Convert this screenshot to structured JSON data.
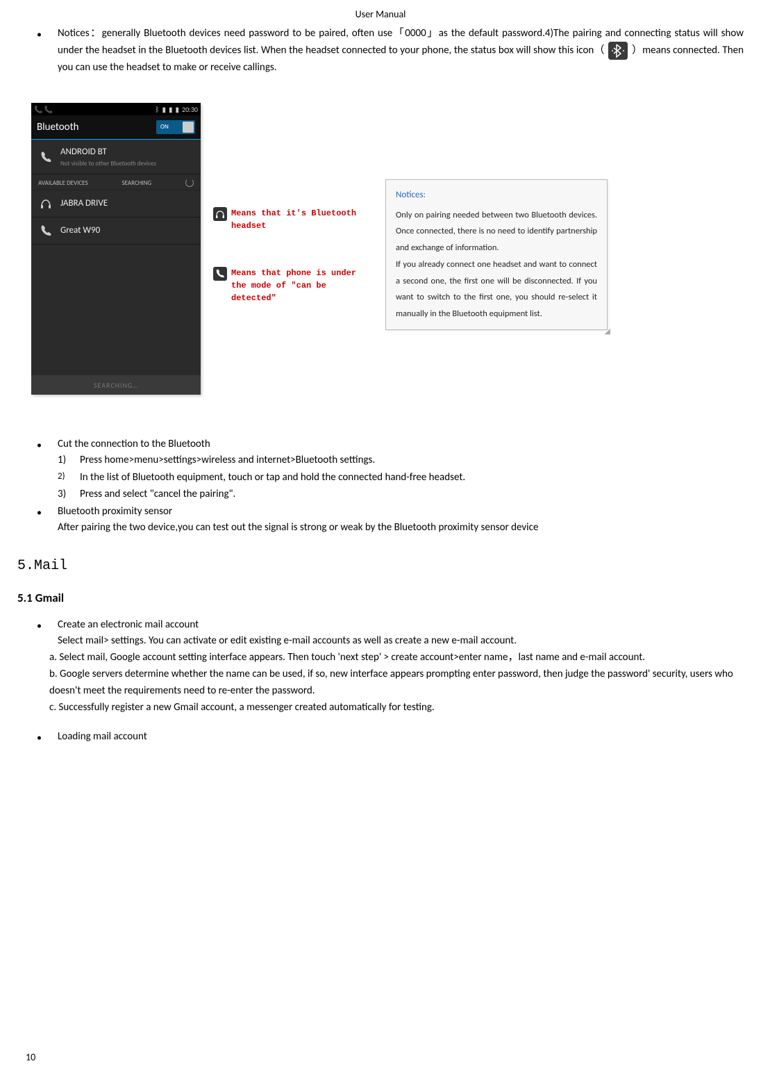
{
  "header": "User    Manual",
  "pageNumber": "10",
  "notices_bullet": {
    "lead": "Notices：generally Bluetooth devices need password to be paired, often use「0000」as the default password.4)The pairing and connecting status will show under the headset in the Bluetooth devices list. When the headset connected to your phone, the status box will show this icon（",
    "tail": "）means connected. Then you can use the headset to make or receive callings."
  },
  "phone": {
    "time": "20:30",
    "title": "Bluetooth",
    "toggle": "ON",
    "self": {
      "name": "ANDROID BT",
      "sub": "Not visible to other Bluetooth devices"
    },
    "labels": {
      "available": "AVAILABLE DEVICES",
      "searching": "SEARCHING"
    },
    "devices": [
      {
        "name": "JABRA DRIVE",
        "icon": "headphones"
      },
      {
        "name": "Great W90",
        "icon": "phone"
      }
    ],
    "footer": "SEARCHING…"
  },
  "callouts": {
    "c1": "Means that it's Bluetooth headset",
    "c2": "Means that phone is under the mode of \"can be detected\""
  },
  "noticeBox": {
    "title": "Notices:",
    "p1": "Only on pairing needed between two Bluetooth devices. Once connected, there is no need to identify partnership and exchange of information.",
    "p2": "If you already connect one headset and want to connect a second one, the first one will be disconnected. If you want to switch to the first one, you should re-select it manually in the Bluetooth equipment list."
  },
  "cut": {
    "title": "Cut the connection to the Bluetooth",
    "s1": "Press home>menu>settings>wireless and internet>Bluetooth settings.",
    "s2": "In the list of Bluetooth equipment, touch or tap and hold the connected hand-free headset.",
    "s3": "Press and select \"cancel the pairing\"."
  },
  "prox": {
    "title": "Bluetooth proximity sensor",
    "body": "After pairing the two device,you can test out the signal is strong or weak by the Bluetooth proximity sensor device"
  },
  "mail": {
    "heading": "5.Mail",
    "sub": "5.1 Gmail",
    "b1": "Create an electronic mail account",
    "p1": "Select mail> settings. You can activate or edit existing e-mail accounts as well as create a new e-mail account.",
    "la": "a.    Select mail, Google account setting interface appears. Then touch 'next step' > create account>enter name，last name and e-mail account.",
    "lb": "b.    Google servers determine whether the name can be used, if so, new interface appears prompting enter password, then judge the password' security, users who doesn't meet the requirements need to re-enter the password.",
    "lc": "c.    Successfully register a new Gmail account, a messenger created automatically for testing.",
    "b2": "Loading mail account"
  }
}
